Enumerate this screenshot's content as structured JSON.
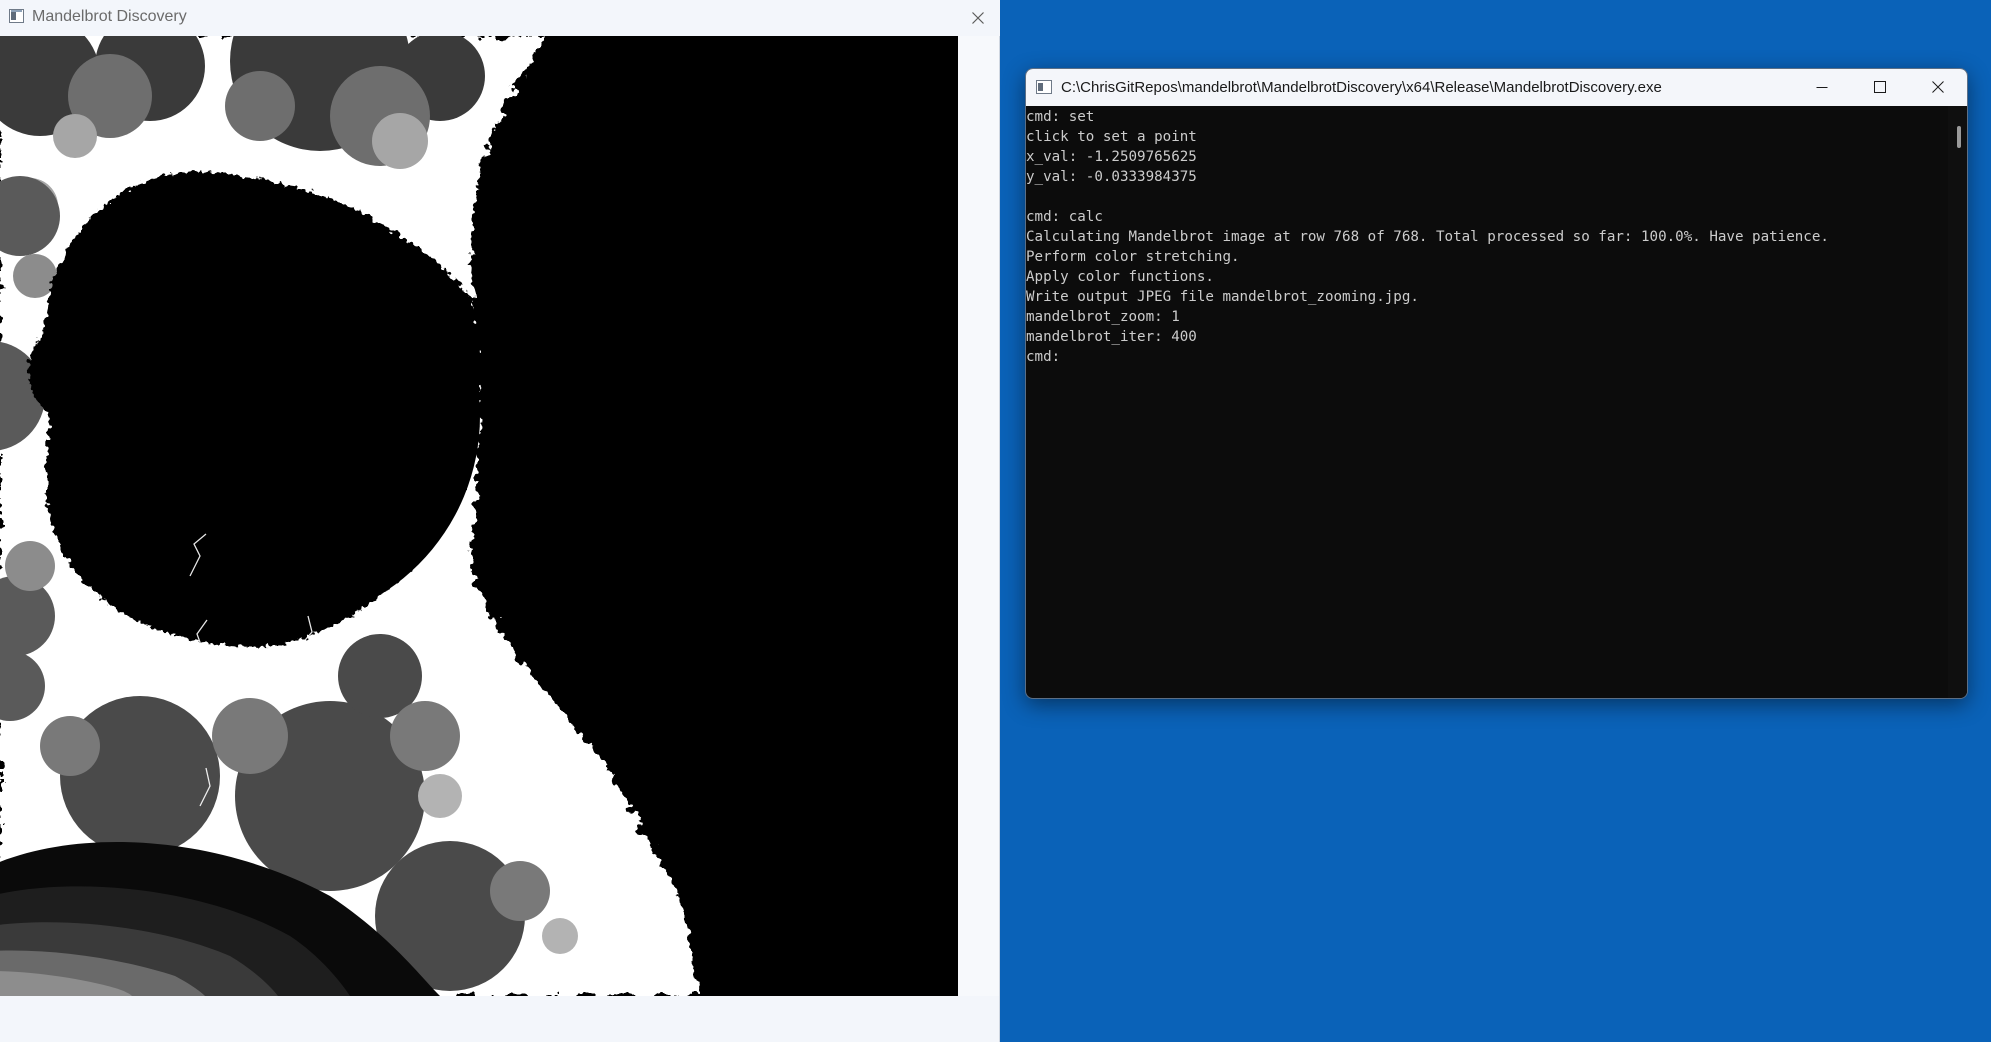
{
  "mandelbrot_window": {
    "title": "Mandelbrot Discovery",
    "close_label": "Close"
  },
  "console_window": {
    "title": "C:\\ChrisGitRepos\\mandelbrot\\MandelbrotDiscovery\\x64\\Release\\MandelbrotDiscovery.exe",
    "lines": [
      "cmd: set",
      "click to set a point",
      "x_val: -1.2509765625",
      "y_val: -0.0333984375",
      "",
      "cmd: calc",
      "Calculating Mandelbrot image at row 768 of 768. Total processed so far: 100.0%. Have patience.",
      "Perform color stretching.",
      "Apply color functions.",
      "Write output JPEG file mandelbrot_zooming.jpg.",
      "mandelbrot_zoom: 1",
      "mandelbrot_iter: 400",
      "cmd:"
    ]
  },
  "colors": {
    "desktop": "#0a62b8",
    "console_background": "#0c0c0c",
    "console_text": "#cccccc"
  },
  "icons": [
    "app-icon",
    "close-icon",
    "minimize-icon",
    "maximize-icon"
  ]
}
